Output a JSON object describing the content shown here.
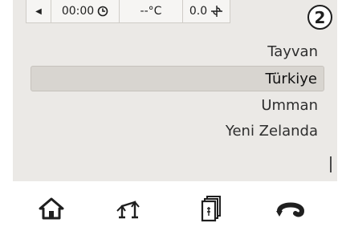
{
  "status_bar": {
    "back_icon": "triangle-left-icon",
    "time": "00:00",
    "time_icon": "clock-icon",
    "temperature": "--°C",
    "fan_value": "0.0",
    "fan_icon": "fan-icon"
  },
  "page_badge": "2",
  "list": {
    "items": [
      {
        "label": "Tayvan",
        "selected": false
      },
      {
        "label": "Türkiye",
        "selected": true
      },
      {
        "label": "Umman",
        "selected": false
      },
      {
        "label": "Yeni Zelanda",
        "selected": false
      }
    ]
  },
  "nav": {
    "items": [
      {
        "icon": "home-icon"
      },
      {
        "icon": "balance-scale-icon"
      },
      {
        "icon": "recipe-book-icon"
      },
      {
        "icon": "back-arrow-icon"
      }
    ]
  },
  "colors": {
    "content_background": "#ebe9e6",
    "selected_row": "#d8d5d0",
    "text": "#2e2e2e"
  }
}
